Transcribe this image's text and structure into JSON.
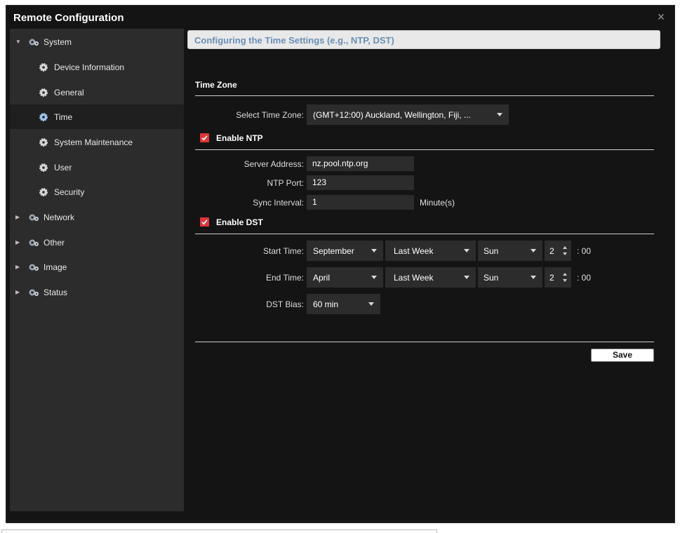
{
  "window": {
    "title": "Remote Configuration",
    "close_glyph": "×"
  },
  "sidebar": {
    "items": [
      {
        "label": "System",
        "type": "group",
        "expanded": true,
        "icon": "gears-icon"
      },
      {
        "label": "Device Information",
        "type": "child",
        "icon": "gear-icon"
      },
      {
        "label": "General",
        "type": "child",
        "icon": "gear-icon"
      },
      {
        "label": "Time",
        "type": "child",
        "selected": true,
        "icon": "gear-icon"
      },
      {
        "label": "System Maintenance",
        "type": "child",
        "icon": "gear-icon"
      },
      {
        "label": "User",
        "type": "child",
        "icon": "gear-icon"
      },
      {
        "label": "Security",
        "type": "child",
        "icon": "gear-icon"
      },
      {
        "label": "Network",
        "type": "group",
        "expanded": false,
        "icon": "gears-icon"
      },
      {
        "label": "Other",
        "type": "group",
        "expanded": false,
        "icon": "gears-icon"
      },
      {
        "label": "Image",
        "type": "group",
        "expanded": false,
        "icon": "gears-icon"
      },
      {
        "label": "Status",
        "type": "group",
        "expanded": false,
        "icon": "gears-icon"
      }
    ]
  },
  "main": {
    "header": "Configuring the Time Settings (e.g., NTP, DST)",
    "time_zone": {
      "section_title": "Time Zone",
      "label": "Select Time Zone:",
      "value": "(GMT+12:00) Auckland, Wellington, Fiji, ..."
    },
    "ntp": {
      "enable_label": "Enable NTP",
      "enabled": true,
      "server_label": "Server Address:",
      "server_value": "nz.pool.ntp.org",
      "port_label": "NTP Port:",
      "port_value": "123",
      "interval_label": "Sync Interval:",
      "interval_value": "1",
      "interval_unit": "Minute(s)"
    },
    "dst": {
      "enable_label": "Enable DST",
      "enabled": true,
      "start_label": "Start Time:",
      "start_month": "September",
      "start_week": "Last Week",
      "start_day": "Sun",
      "start_hour": "2",
      "start_suffix": ": 00",
      "end_label": "End Time:",
      "end_month": "April",
      "end_week": "Last Week",
      "end_day": "Sun",
      "end_hour": "2",
      "end_suffix": ": 00",
      "bias_label": "DST Bias:",
      "bias_value": "60 min"
    },
    "save_label": "Save"
  },
  "colors": {
    "background": "#141414",
    "sidebar": "#2c2c2c",
    "header_text": "#6a8fb5",
    "checkbox": "#e0343a"
  }
}
